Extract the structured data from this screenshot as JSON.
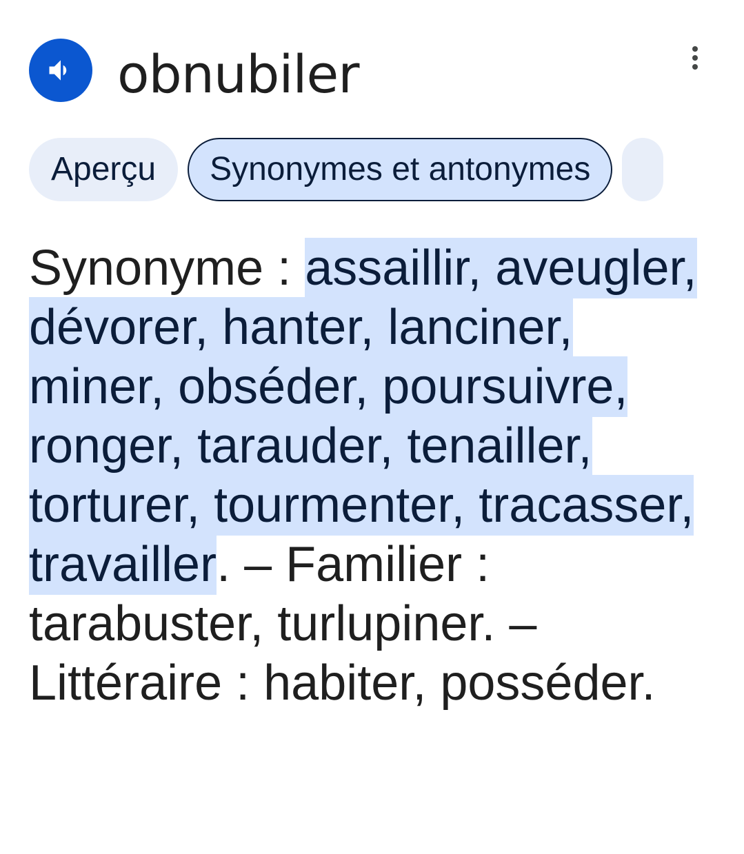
{
  "header": {
    "word": "obnubiler",
    "speaker_icon": "volume-up-icon",
    "more_icon": "more-vert-icon",
    "accent_color": "#0b57d0"
  },
  "tabs": [
    {
      "label": "Aperçu",
      "selected": false
    },
    {
      "label": "Synonymes et antonymes",
      "selected": true
    },
    {
      "label": "",
      "selected": false
    }
  ],
  "definition": {
    "synonym_label": "Synonyme : ",
    "synonyms_highlighted": "assaillir, aveugler, dévorer, hanter, lanciner, miner, obséder, poursuivre, ronger, tarauder, tenailler, torturer, tourmenter, tracasser, travailler",
    "rest": ". – Familier : tarabuster, turlupiner. – Littéraire : habiter, posséder.",
    "highlight_color": "#d3e3fd"
  }
}
